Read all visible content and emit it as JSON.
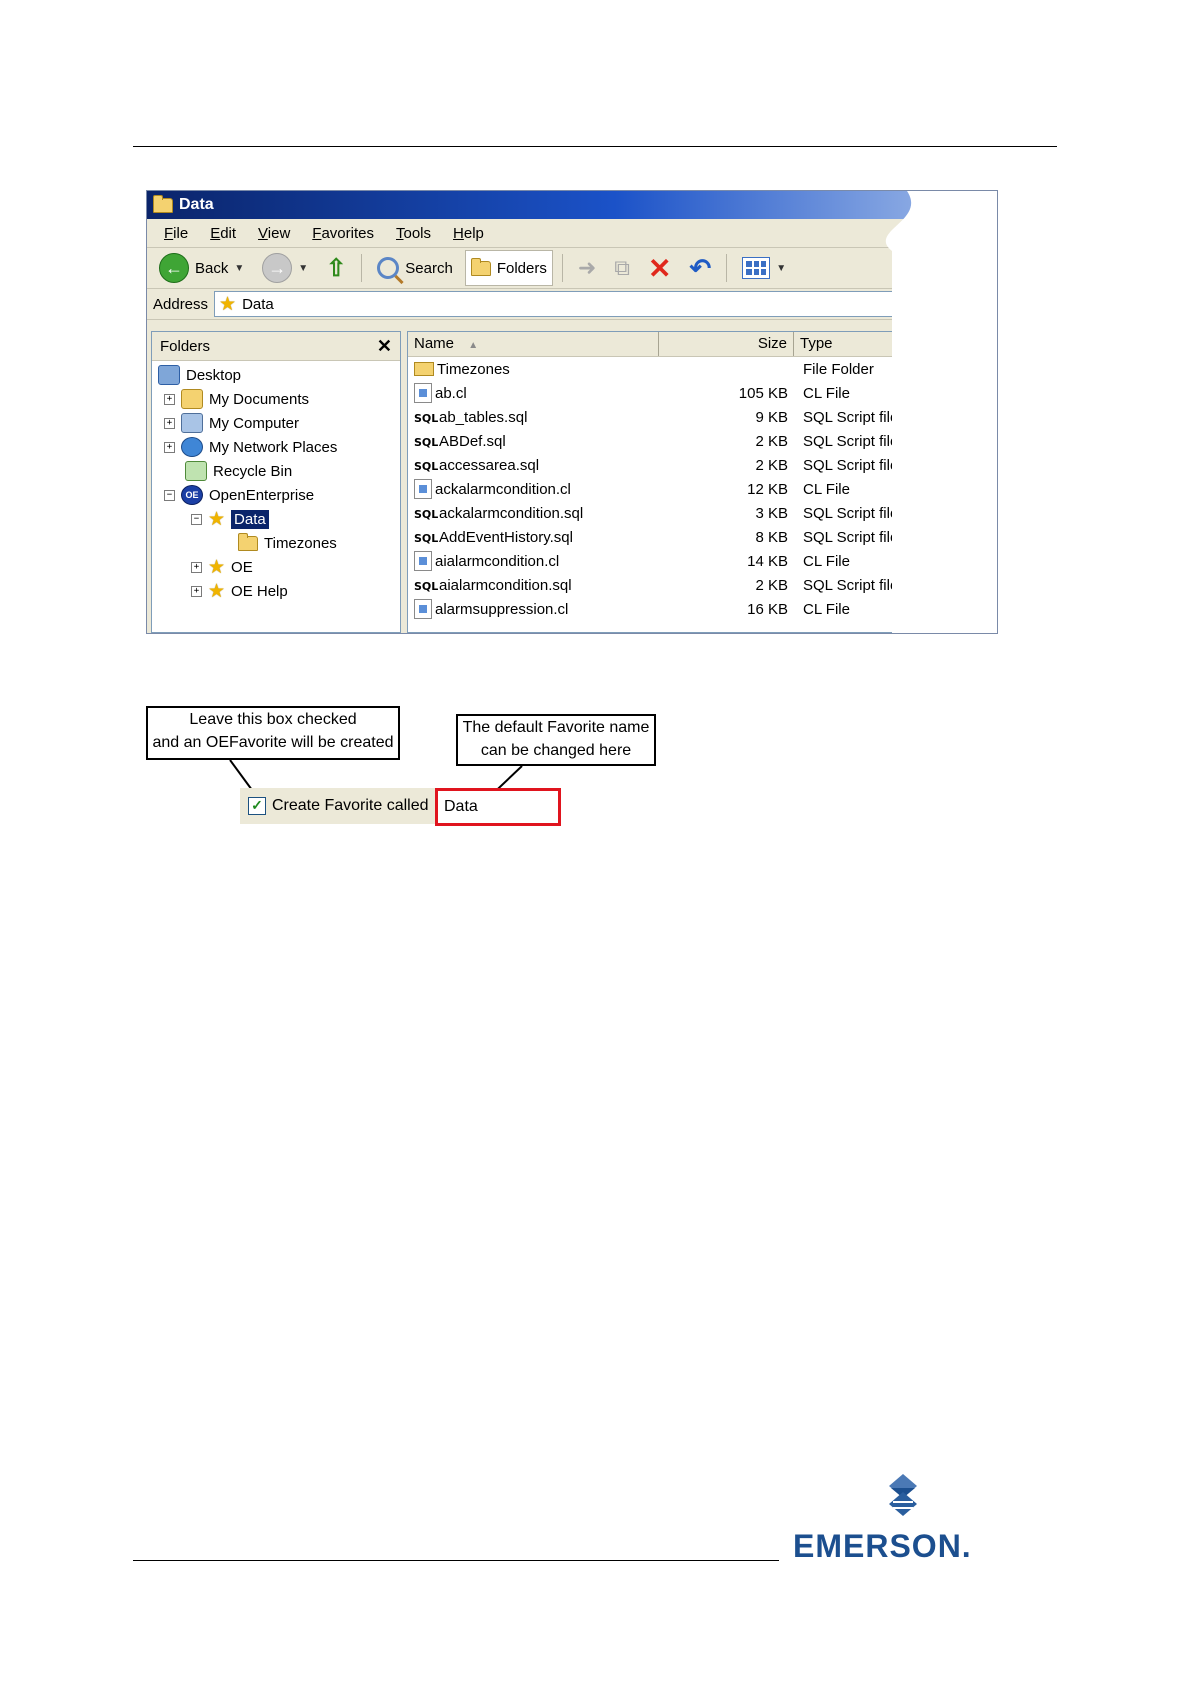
{
  "window": {
    "title": "Data",
    "menu": [
      "File",
      "Edit",
      "View",
      "Favorites",
      "Tools",
      "Help"
    ],
    "toolbar": {
      "back": "Back",
      "search": "Search",
      "folders": "Folders"
    },
    "address": {
      "label": "Address",
      "value": "Data"
    }
  },
  "folders_pane": {
    "title": "Folders",
    "tree": [
      {
        "label": "Desktop",
        "icon": "desktop-icon"
      },
      {
        "label": "My Documents",
        "icon": "my-documents-icon"
      },
      {
        "label": "My Computer",
        "icon": "my-computer-icon"
      },
      {
        "label": "My Network Places",
        "icon": "network-places-icon"
      },
      {
        "label": "Recycle Bin",
        "icon": "recycle-bin-icon"
      },
      {
        "label": "OpenEnterprise",
        "icon": "openenterprise-icon"
      },
      {
        "label": "Data",
        "icon": "favorite-star-icon"
      },
      {
        "label": "Timezones",
        "icon": "folder-icon"
      },
      {
        "label": "OE",
        "icon": "favorite-star-icon"
      },
      {
        "label": "OE Help",
        "icon": "favorite-star-icon"
      }
    ]
  },
  "file_list": {
    "columns": [
      "Name",
      "Size",
      "Type"
    ],
    "rows": [
      {
        "name": "Timezones",
        "size": "",
        "type": "File Folder",
        "icon": "folder"
      },
      {
        "name": "ab.cl",
        "size": "105 KB",
        "type": "CL File",
        "icon": "cl"
      },
      {
        "name": "ab_tables.sql",
        "size": "9 KB",
        "type": "SQL Script file",
        "icon": "sql"
      },
      {
        "name": "ABDef.sql",
        "size": "2 KB",
        "type": "SQL Script file",
        "icon": "sql"
      },
      {
        "name": "accessarea.sql",
        "size": "2 KB",
        "type": "SQL Script file",
        "icon": "sql"
      },
      {
        "name": "ackalarmcondition.cl",
        "size": "12 KB",
        "type": "CL File",
        "icon": "cl"
      },
      {
        "name": "ackalarmcondition.sql",
        "size": "3 KB",
        "type": "SQL Script file",
        "icon": "sql"
      },
      {
        "name": "AddEventHistory.sql",
        "size": "8 KB",
        "type": "SQL Script file",
        "icon": "sql"
      },
      {
        "name": "aialarmcondition.cl",
        "size": "14 KB",
        "type": "CL File",
        "icon": "cl"
      },
      {
        "name": "aialarmcondition.sql",
        "size": "2 KB",
        "type": "SQL Script file",
        "icon": "sql"
      },
      {
        "name": "alarmsuppression.cl",
        "size": "16 KB",
        "type": "CL File",
        "icon": "cl"
      }
    ]
  },
  "callouts": {
    "checkbox_note": [
      "Leave this box checked",
      "and an OEFavorite will be created"
    ],
    "name_note": [
      "The default Favorite name",
      "can be changed here"
    ]
  },
  "favorite": {
    "checkbox_label": "Create Favorite called",
    "checked": true,
    "name_value": "Data"
  },
  "logo": {
    "text": "EMERSON."
  },
  "colors": {
    "selection": "#0a246a",
    "highlight_border": "#e0141e",
    "logo_blue": "#1c4f8f"
  }
}
